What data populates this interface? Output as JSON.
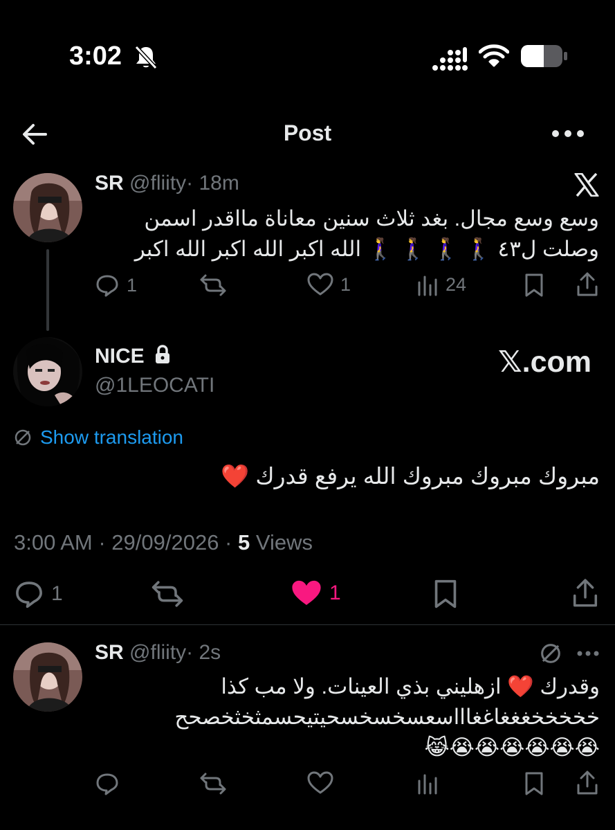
{
  "status_bar": {
    "time": "3:02"
  },
  "nav": {
    "title": "Post"
  },
  "quoted_post": {
    "display_name": "SR",
    "handle": "@fliity",
    "time": "· 18m",
    "line1": "وسع وسع مجال.  بغد ثلاث سنين معاناة مااقدر اسمن",
    "line2": "وصلت ل٤٣  🚶‍♀️ 🚶‍♀️ 🚶‍♀️ 🚶‍♀️  الله اكبر الله اكبر الله اكبر",
    "stats": {
      "replies": "1",
      "likes": "1",
      "views": "24"
    }
  },
  "main_post": {
    "display_name": "NICE",
    "handle": "@1LEOCATI",
    "watermark": "𝕏.com",
    "show_translation": "Show translation",
    "text": "مبروك مبروك مبروك الله يرفع قدرك ❤️",
    "timestamp": "3:00 AM · 29/09/2026 · ",
    "views_count": "5",
    "views_label": " Views",
    "stats": {
      "replies": "1",
      "likes": "1"
    },
    "like_color": "#f91880"
  },
  "reply": {
    "display_name": "SR",
    "handle": "@fliity",
    "time": "· 2s",
    "line1": "وقدرك ❤️ ازهليني بذي العينات.   ولا مب كذا",
    "line2": "خخخخخغغغاغغاااسعسخسخسحيتيحسمثخثخصحح",
    "line3": "😭😭😭😭😭😭😹"
  }
}
